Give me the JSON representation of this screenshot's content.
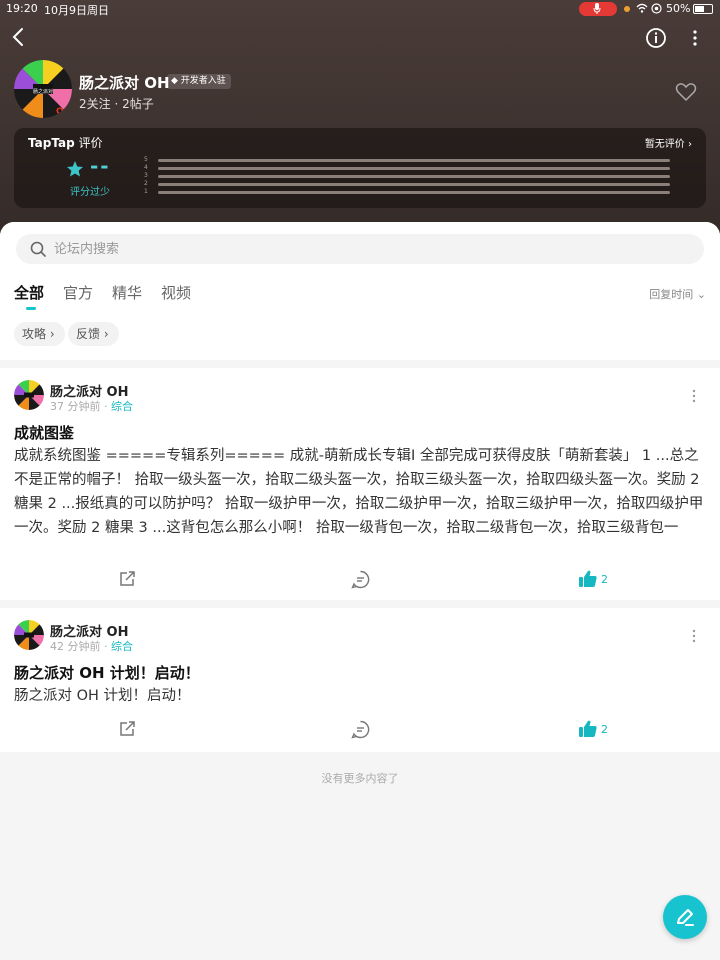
{
  "status_bar": {
    "time": "19:20",
    "date": "10月9日周日",
    "battery": "50%"
  },
  "app": {
    "name": "肠之派对 OH",
    "badge": "开发者入驻",
    "stats": "2关注 · 2帖子",
    "logo_text": "肠之派对"
  },
  "rating": {
    "brand": "TapTap",
    "label": "评价",
    "none_label": "暂无评价 ›",
    "score": "--",
    "low_text": "评分过少",
    "rows": [
      "5",
      "4",
      "3",
      "2",
      "1"
    ]
  },
  "search": {
    "placeholder": "论坛内搜索"
  },
  "tabs": [
    {
      "label": "全部",
      "active": true
    },
    {
      "label": "官方",
      "active": false
    },
    {
      "label": "精华",
      "active": false
    },
    {
      "label": "视频",
      "active": false
    }
  ],
  "sort_label": "回复时间",
  "chips": [
    "攻略",
    "反馈"
  ],
  "posts": [
    {
      "author": "肠之派对 OH",
      "time": "37 分钟前",
      "category": "综合",
      "title": "成就图鉴",
      "body": "成就系统图鉴 =====专辑系列===== 成就-萌新成长专辑I 全部完成可获得皮肤「萌新套装」 1 ...总之不是正常的帽子！ 拾取一级头盔一次，拾取二级头盔一次，拾取三级头盔一次，拾取四级头盔一次。奖励 2 糖果 2 ...报纸真的可以防护吗？ 拾取一级护甲一次，拾取二级护甲一次，拾取三级护甲一次，拾取四级护甲一次。奖励 2 糖果 3 ...这背包怎么那么小啊！ 拾取一级背包一次，拾取二级背包一次，拾取三级背包一",
      "likes": "2"
    },
    {
      "author": "肠之派对 OH",
      "time": "42 分钟前",
      "category": "综合",
      "title": "肠之派对 OH 计划！启动！",
      "body": "肠之派对 OH 计划！启动！",
      "likes": "2"
    }
  ],
  "end_text": "没有更多内容了",
  "colors": {
    "accent": "#15c5ce",
    "header_bg": "#3d322f",
    "mic_red": "#e53935"
  }
}
